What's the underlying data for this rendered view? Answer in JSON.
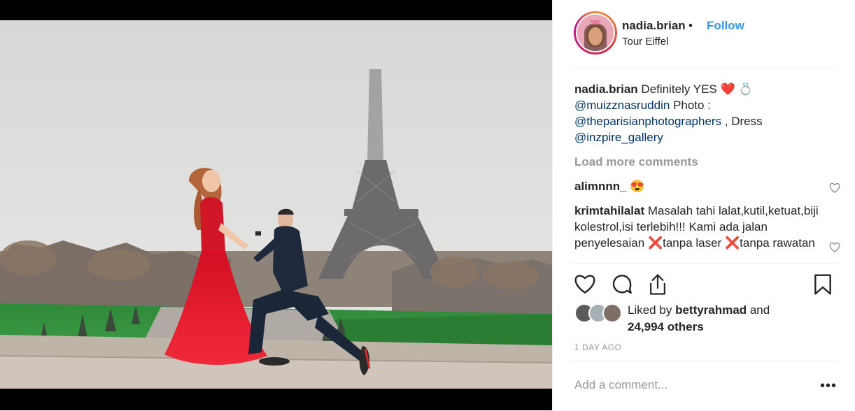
{
  "post": {
    "username": "nadia.brian",
    "separator": "•",
    "follow_label": "Follow",
    "location": "Tour Eiffel"
  },
  "caption": {
    "username": "nadia.brian",
    "text": "Definitely YES",
    "emoji": "❤️ 💍",
    "mention_1": "@muizznasruddin",
    "photo_label": "Photo :",
    "mention_2": "@theparisianphotographers",
    "dress_label": ", Dress",
    "mention_3": "@inzpire_gallery"
  },
  "load_more_label": "Load more comments",
  "comments": [
    {
      "username": "alimnnn_",
      "text": "😍"
    },
    {
      "username": "krimtahilalat",
      "text": "Masalah tahi lalat,kutil,ketuat,biji kolestrol,isi terlebih!!! Kami ada jalan penyelesaian",
      "text_2": "tanpa laser",
      "text_3": "tanpa rawatan",
      "mark": "❌"
    }
  ],
  "likes": {
    "prefix": "Liked by",
    "user": "bettyrahmad",
    "and": "and",
    "others": "24,994 others"
  },
  "timestamp": "1 DAY AGO",
  "add_comment_placeholder": "Add a comment...",
  "more_glyph": "•••",
  "icons": [
    "heart-icon",
    "comment-icon",
    "share-icon",
    "bookmark-icon",
    "more-icon"
  ],
  "colors": {
    "link": "#3897f0",
    "mention": "#003569",
    "muted": "#999999",
    "heart": "#ed4956",
    "dress": "#e8182b"
  }
}
